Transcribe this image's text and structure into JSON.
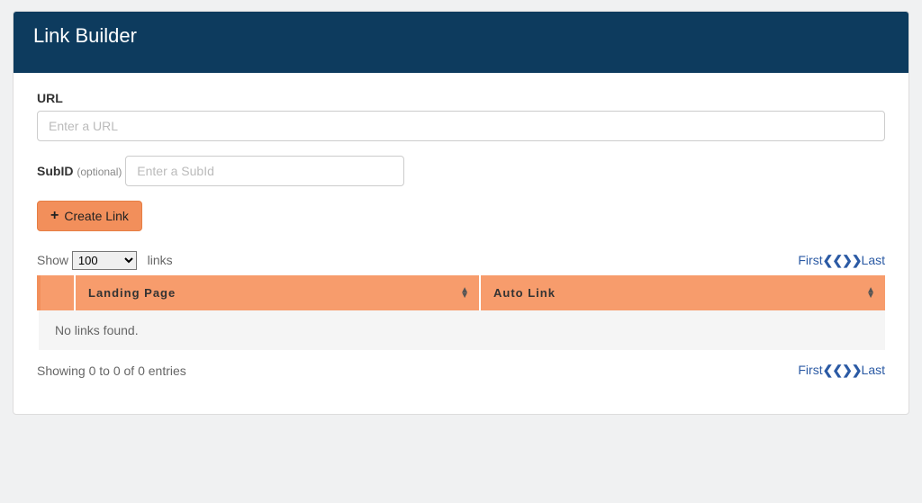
{
  "header": {
    "title": "Link Builder"
  },
  "form": {
    "url_label": "URL",
    "url_placeholder": "Enter a URL",
    "subid_label": "SubID",
    "subid_optional": "(optional)",
    "subid_placeholder": "Enter a SubId",
    "create_button": "Create Link"
  },
  "table": {
    "show_prefix": "Show",
    "show_suffix": "links",
    "length_value": "100",
    "pager_first": "First",
    "pager_last": "Last",
    "columns": {
      "landing_page": "Landing Page",
      "auto_link": "Auto Link"
    },
    "empty": "No links found.",
    "info": "Showing 0 to 0 of 0 entries"
  }
}
